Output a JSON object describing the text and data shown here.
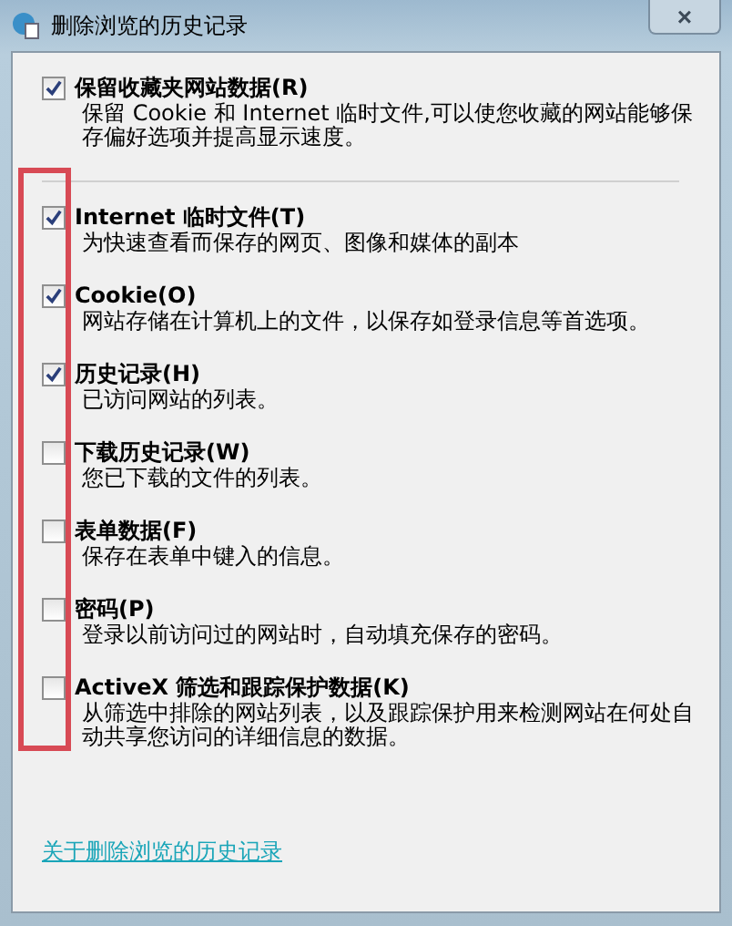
{
  "window": {
    "title": "删除浏览的历史记录",
    "close": "×"
  },
  "top_option": {
    "label": "保留收藏夹网站数据(R)",
    "checked": true,
    "description": "保留 Cookie 和 Internet 临时文件,可以使您收藏的网站能够保存偏好选项并提高显示速度。"
  },
  "options": [
    {
      "label": "Internet 临时文件(T)",
      "checked": true,
      "description": "为快速查看而保存的网页、图像和媒体的副本"
    },
    {
      "label": "Cookie(O)",
      "checked": true,
      "description": "网站存储在计算机上的文件，以保存如登录信息等首选项。"
    },
    {
      "label": "历史记录(H)",
      "checked": true,
      "description": "已访问网站的列表。"
    },
    {
      "label": "下载历史记录(W)",
      "checked": false,
      "description": "您已下载的文件的列表。"
    },
    {
      "label": "表单数据(F)",
      "checked": false,
      "description": "保存在表单中键入的信息。"
    },
    {
      "label": "密码(P)",
      "checked": false,
      "description": "登录以前访问过的网站时，自动填充保存的密码。"
    },
    {
      "label": "ActiveX 筛选和跟踪保护数据(K)",
      "checked": false,
      "description": "从筛选中排除的网站列表，以及跟踪保护用来检测网站在何处自动共享您访问的详细信息的数据。"
    }
  ],
  "link": "关于删除浏览的历史记录"
}
